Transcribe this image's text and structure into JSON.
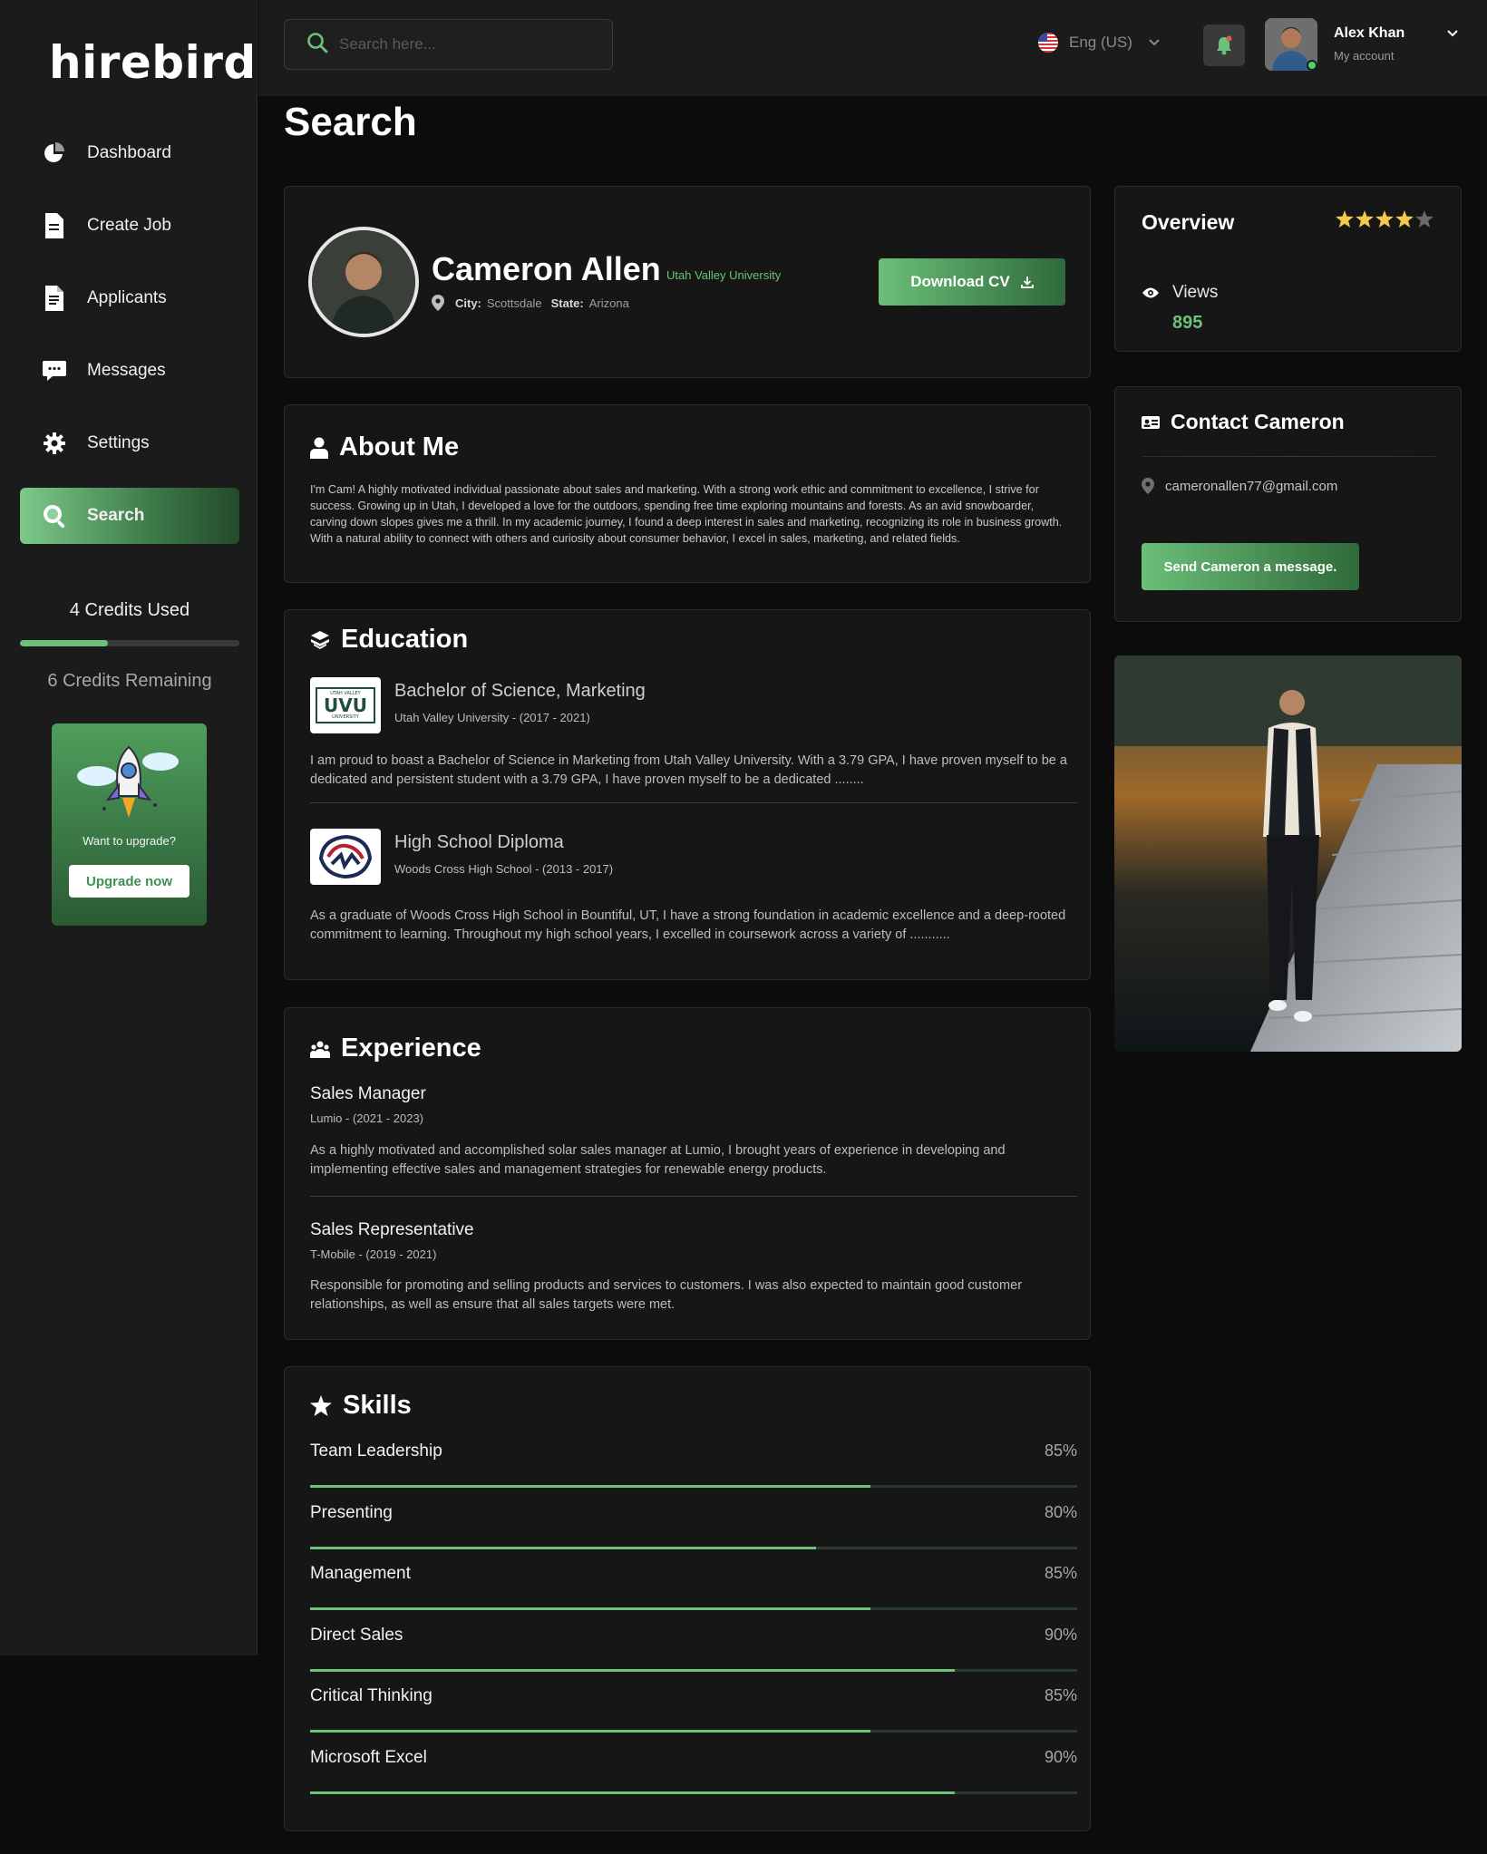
{
  "app": {
    "logo": "hirebird"
  },
  "sidebar": {
    "items": [
      {
        "label": "Dashboard",
        "icon": "pie-chart-icon",
        "active": false
      },
      {
        "label": "Create Job",
        "icon": "document-icon",
        "active": false
      },
      {
        "label": "Applicants",
        "icon": "document-lines-icon",
        "active": false
      },
      {
        "label": "Messages",
        "icon": "chat-bubble-icon",
        "active": false
      },
      {
        "label": "Settings",
        "icon": "gear-icon",
        "active": true
      },
      {
        "label": "Search",
        "icon": "search-icon",
        "active": true
      }
    ],
    "credits_used_label": "4 Credits Used",
    "credits_remaining_label": "6 Credits Remaining",
    "credits_used_fraction": 0.4,
    "upgrade": {
      "text": "Want to upgrade?",
      "button": "Upgrade now"
    }
  },
  "topbar": {
    "search_placeholder": "Search here...",
    "language": "Eng (US)",
    "user": {
      "name": "Alex Khan",
      "subtitle": "My account"
    }
  },
  "page": {
    "title": "Search"
  },
  "profile": {
    "name": "Cameron Allen",
    "university": "Utah Valley University",
    "city_label": "City:",
    "city": "Scottsdale",
    "state_label": "State:",
    "state": "Arizona",
    "download_button": "Download CV"
  },
  "about": {
    "title": "About Me",
    "text": "I'm Cam! A highly motivated individual passionate about sales and marketing. With a strong work ethic and commitment to excellence, I strive for success. Growing up in Utah, I developed a love for the outdoors, spending free time exploring mountains and forests. As an avid snowboarder, carving down slopes gives me a thrill. In my academic journey, I found a deep interest in sales and marketing, recognizing its role in business growth. With a natural ability to connect with others and curiosity about consumer behavior, I excel in sales, marketing, and related fields."
  },
  "education": {
    "title": "Education",
    "items": [
      {
        "degree": "Bachelor of Science, Marketing",
        "school": "Utah Valley University - (2017 - 2021)",
        "logo_text": "UVU",
        "logo_top": "UTAH VALLEY",
        "logo_bottom": "UNIVERSITY",
        "description": "I am proud to boast a Bachelor of Science in Marketing from Utah Valley University. With a 3.79 GPA, I have proven myself to be a dedicated and persistent student with a 3.79 GPA, I have proven myself to be a dedicated ........"
      },
      {
        "degree": "High School Diploma",
        "school": "Woods Cross High School - (2013 - 2017)",
        "description": "As a graduate of Woods Cross High School in Bountiful, UT, I have a strong foundation in academic excellence and a deep-rooted commitment to learning. Throughout my high school years, I excelled in coursework across a variety of ..........."
      }
    ]
  },
  "experience": {
    "title": "Experience",
    "items": [
      {
        "role": "Sales Manager",
        "company": "Lumio - (2021 - 2023)",
        "description": "As a highly motivated and accomplished solar sales manager at Lumio, I brought years of experience in developing and implementing effective sales and management strategies for renewable energy products."
      },
      {
        "role": "Sales Representative",
        "company": "T-Mobile - (2019 - 2021)",
        "description": "Responsible for promoting and selling products and services to customers. I was also expected to maintain good customer relationships, as well as ensure that all sales targets were met."
      }
    ]
  },
  "skills": {
    "title": "Skills",
    "items": [
      {
        "label": "Team Leadership",
        "percent_label": "85%",
        "value": 0.73
      },
      {
        "label": "Presenting",
        "percent_label": "80%",
        "value": 0.66
      },
      {
        "label": "Management",
        "percent_label": "85%",
        "value": 0.73
      },
      {
        "label": "Direct Sales",
        "percent_label": "90%",
        "value": 0.84
      },
      {
        "label": "Critical Thinking",
        "percent_label": "85%",
        "value": 0.73
      },
      {
        "label": "Microsoft Excel",
        "percent_label": "90%",
        "value": 0.84
      }
    ]
  },
  "overview": {
    "title": "Overview",
    "rating": 4,
    "rating_max": 5,
    "views_label": "Views",
    "views_count": "895"
  },
  "contact": {
    "title": "Contact Cameron",
    "email": "cameronallen77@gmail.com",
    "button": "Send Cameron a message."
  },
  "colors": {
    "accent": "#6cc27a",
    "background": "#0c0c0c",
    "panel": "#1b1b1c",
    "star": "#f2c94c"
  }
}
